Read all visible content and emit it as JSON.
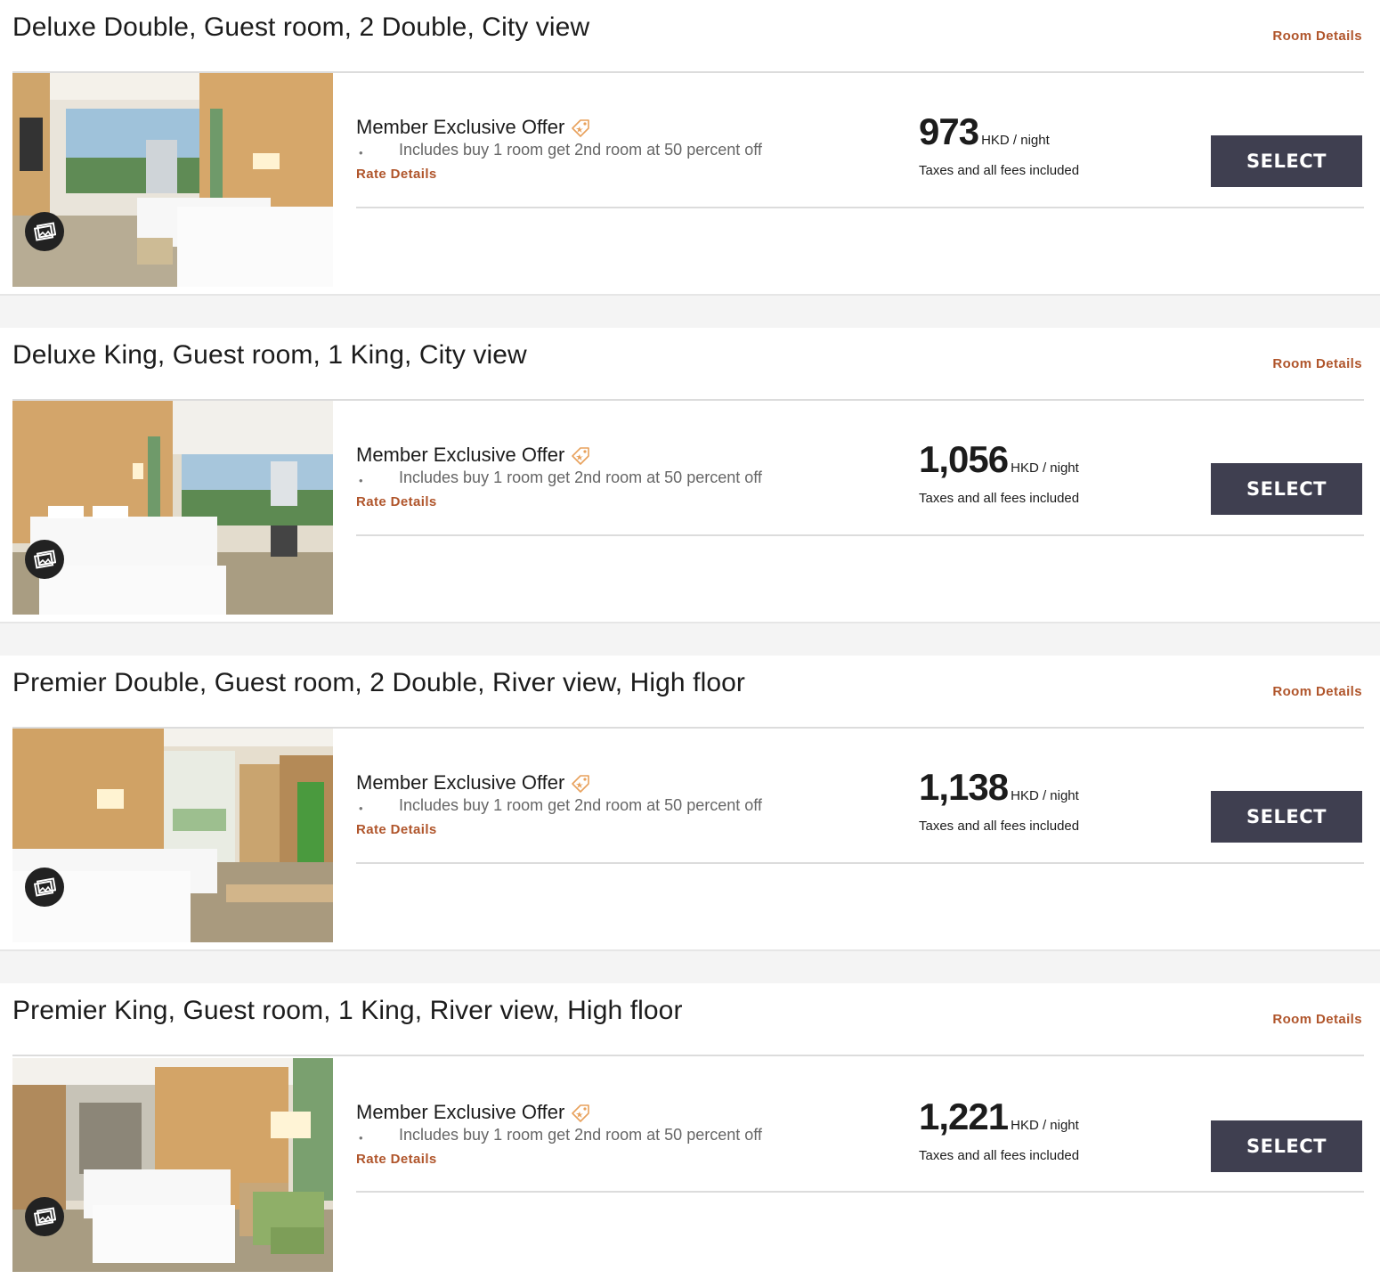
{
  "rooms": [
    {
      "title": "Deluxe Double, Guest room, 2 Double, City view",
      "room_details_label": "Room Details",
      "offer_title": "Member Exclusive Offer",
      "offer_bullet": "•",
      "offer_desc": "Includes buy 1 room get 2nd room at 50 percent off",
      "rate_details_label": "Rate Details",
      "price": "973",
      "price_unit": "HKD / night",
      "price_note": "Taxes and all fees included",
      "select_label": "SELECT",
      "photo": "two-double-beds-city-view"
    },
    {
      "title": "Deluxe King, Guest room, 1 King, City view",
      "room_details_label": "Room Details",
      "offer_title": "Member Exclusive Offer",
      "offer_bullet": "•",
      "offer_desc": "Includes buy 1 room get 2nd room at 50 percent off",
      "rate_details_label": "Rate Details",
      "price": "1,056",
      "price_unit": "HKD / night",
      "price_note": "Taxes and all fees included",
      "select_label": "SELECT",
      "photo": "king-bed-city-view"
    },
    {
      "title": "Premier Double, Guest room, 2 Double, River view, High floor",
      "room_details_label": "Room Details",
      "offer_title": "Member Exclusive Offer",
      "offer_bullet": "•",
      "offer_desc": "Includes buy 1 room get 2nd room at 50 percent off",
      "rate_details_label": "Rate Details",
      "price": "1,138",
      "price_unit": "HKD / night",
      "price_note": "Taxes and all fees included",
      "select_label": "SELECT",
      "photo": "two-double-beds-corridor"
    },
    {
      "title": "Premier King, Guest room, 1 King, River view, High floor",
      "room_details_label": "Room Details",
      "offer_title": "Member Exclusive Offer",
      "offer_bullet": "•",
      "offer_desc": "Includes buy 1 room get 2nd room at 50 percent off",
      "rate_details_label": "Rate Details",
      "price": "1,221",
      "price_unit": "HKD / night",
      "price_note": "Taxes and all fees included",
      "select_label": "SELECT",
      "photo": "king-bed-green-chair"
    }
  ],
  "colors": {
    "link": "#b0552b",
    "select_button": "#3f3f50",
    "divider": "#dcdcdc",
    "page_bg": "#f4f4f4"
  },
  "icons": {
    "gallery": "gallery-icon",
    "offer_tag": "offer-tag-icon"
  }
}
